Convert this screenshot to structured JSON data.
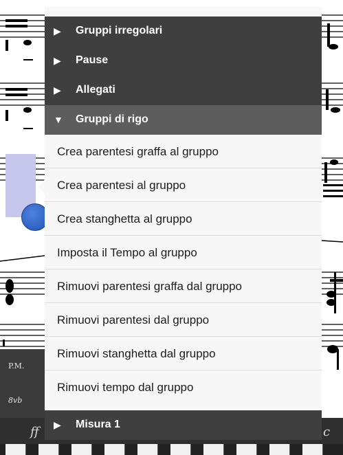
{
  "menu": {
    "sections_top": [
      {
        "label": "Gruppi irregolari",
        "state": "collapsed"
      },
      {
        "label": "Pause",
        "state": "collapsed"
      },
      {
        "label": "Allegati",
        "state": "collapsed"
      }
    ],
    "expanded_section": {
      "label": "Gruppi di rigo",
      "state": "expanded"
    },
    "items": [
      {
        "label": "Crea parentesi graffa al gruppo"
      },
      {
        "label": "Crea parentesi al gruppo"
      },
      {
        "label": "Crea stanghetta al gruppo"
      },
      {
        "label": "Imposta il Tempo al gruppo"
      },
      {
        "label": "Rimuovi parentesi graffa dal gruppo"
      },
      {
        "label": "Rimuovi parentesi dal gruppo"
      },
      {
        "label": "Rimuovi stanghetta dal gruppo"
      },
      {
        "label": "Rimuovi tempo dal gruppo"
      }
    ],
    "bottom_section": {
      "label": "Misura 1",
      "state": "collapsed"
    },
    "icons": {
      "collapsed": "triangle-right-icon",
      "expanded": "triangle-down-icon"
    }
  },
  "palette": {
    "pm_label": "P.M.",
    "vb_label": "8vb",
    "dynamic_glyph": "ff",
    "right_glyph": "c"
  },
  "colors": {
    "section_bg": "#3f3f3f",
    "expanded_section_bg": "#5d5d5d",
    "item_bg": "#f7f7f7",
    "selection": "#c7c6ec",
    "handle": "#2c63c7"
  }
}
